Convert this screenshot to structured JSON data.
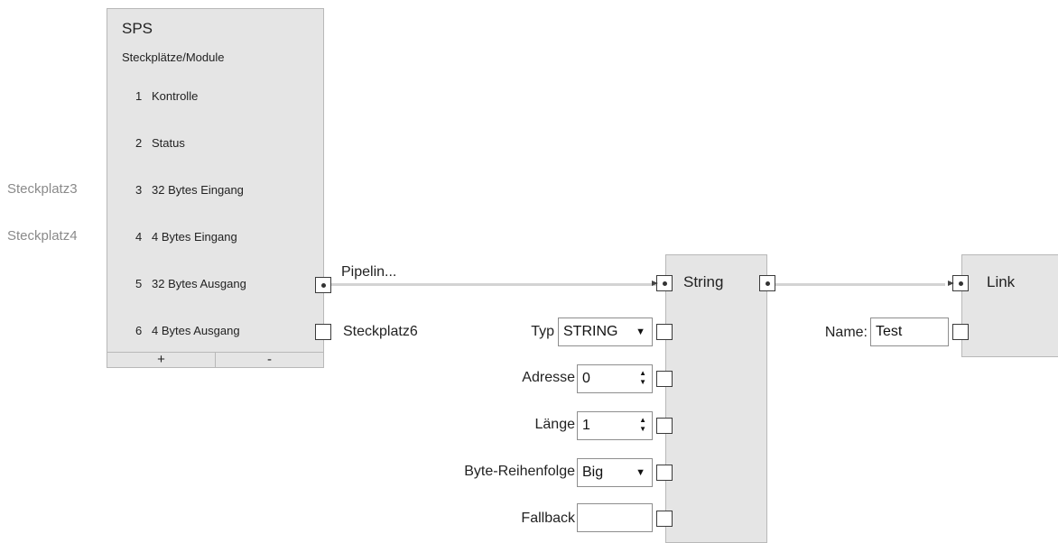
{
  "sps": {
    "title": "SPS",
    "subtitle": "Steckplätze/Module",
    "slots": [
      {
        "num": "1",
        "name": "Kontrolle"
      },
      {
        "num": "2",
        "name": "Status"
      },
      {
        "num": "3",
        "name": "32 Bytes Eingang"
      },
      {
        "num": "4",
        "name": "4 Bytes Eingang"
      },
      {
        "num": "5",
        "name": "32 Bytes Ausgang"
      },
      {
        "num": "6",
        "name": "4 Bytes Ausgang"
      }
    ],
    "add_label": "+",
    "remove_label": "-"
  },
  "side_labels": {
    "slot3": "Steckplatz3",
    "slot4": "Steckplatz4"
  },
  "connections": {
    "pipeline_label": "Pipelin...",
    "slot6_label": "Steckplatz6"
  },
  "string_node": {
    "title": "String",
    "fields": {
      "typ": {
        "label": "Typ",
        "value": "STRING"
      },
      "adresse": {
        "label": "Adresse",
        "value": "0"
      },
      "laenge": {
        "label": "Länge",
        "value": "1"
      },
      "byte_order": {
        "label": "Byte-Reihenfolge",
        "value": "Big"
      },
      "fallback": {
        "label": "Fallback",
        "value": ""
      }
    }
  },
  "link_node": {
    "title": "Link",
    "name_label": "Name:",
    "name_value": "Test"
  }
}
